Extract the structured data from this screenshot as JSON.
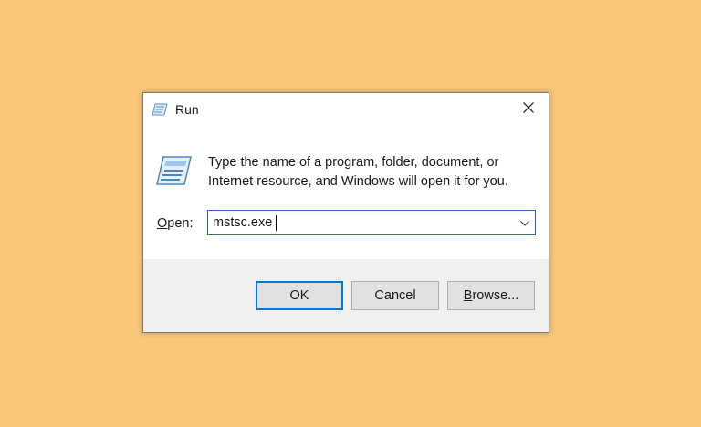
{
  "dialog": {
    "title": "Run",
    "description": "Type the name of a program, folder, document, or Internet resource, and Windows will open it for you.",
    "open_label_accel": "O",
    "open_label_rest": "pen:",
    "command_value": "mstsc.exe",
    "buttons": {
      "ok": "OK",
      "cancel": "Cancel",
      "browse_accel": "B",
      "browse_rest": "rowse..."
    }
  },
  "colors": {
    "background": "#f8c679",
    "accent": "#0078d7",
    "footer": "#f0f0f0"
  },
  "icons": [
    "run-icon",
    "close-icon",
    "chevron-down-icon"
  ]
}
